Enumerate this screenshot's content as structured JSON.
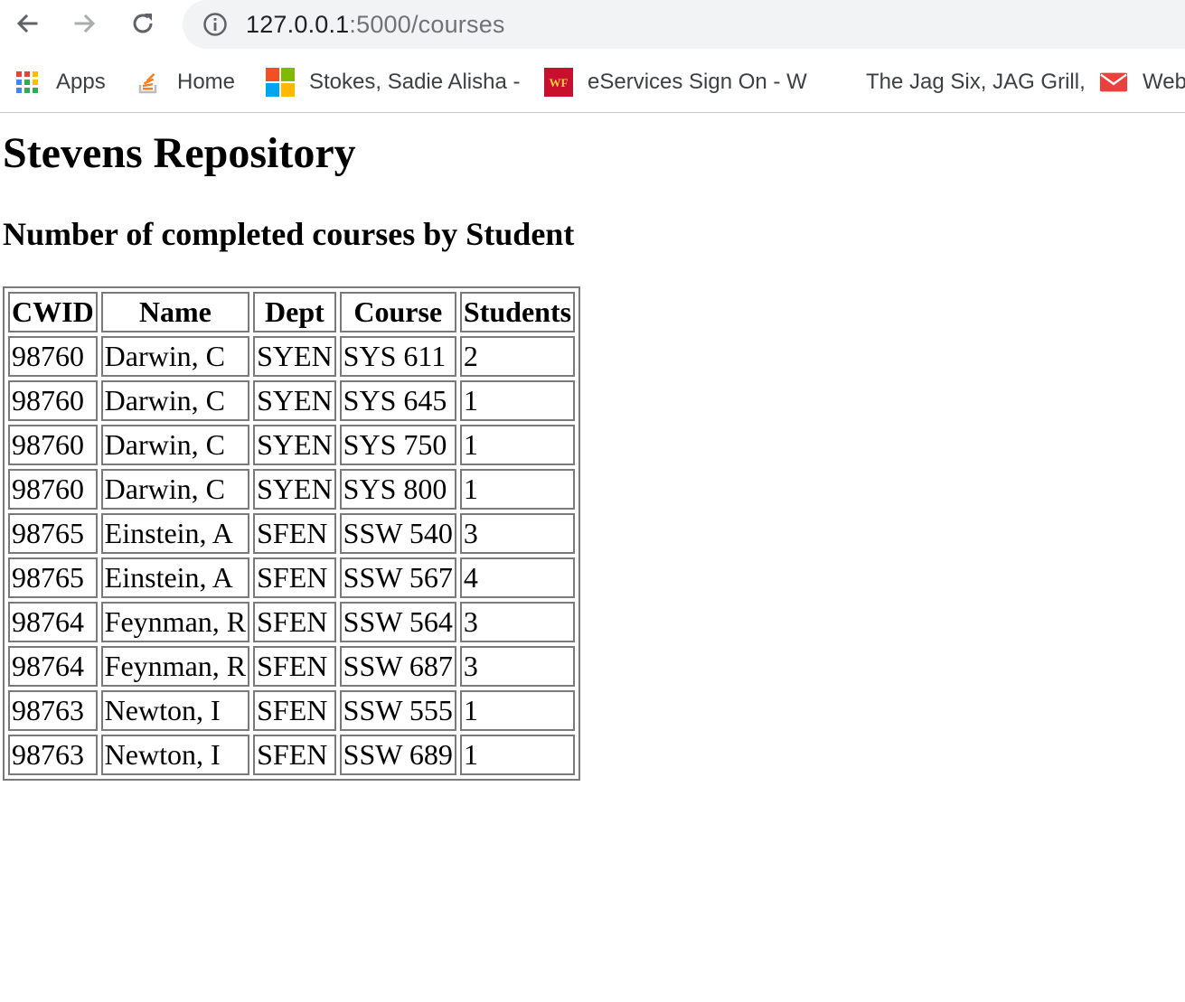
{
  "browser": {
    "url_host": "127.0.0.1",
    "url_path": ":5000/courses",
    "bookmarks": [
      {
        "label": "Apps",
        "icon": "apps-grid-icon"
      },
      {
        "label": "Home",
        "icon": "stackoverflow-icon"
      },
      {
        "label": "Stokes, Sadie Alisha -",
        "icon": "microsoft-icon"
      },
      {
        "label": "eServices Sign On - W",
        "icon": "wells-fargo-icon"
      },
      {
        "label": "The Jag Six, JAG Grill,",
        "icon": ""
      },
      {
        "label": "Web",
        "icon": "mail-envelope-icon"
      }
    ]
  },
  "page": {
    "title": "Stevens Repository",
    "subtitle": "Number of completed courses by Student"
  },
  "table": {
    "headers": [
      "CWID",
      "Name",
      "Dept",
      "Course",
      "Students"
    ],
    "rows": [
      [
        "98760",
        "Darwin, C",
        "SYEN",
        "SYS 611",
        "2"
      ],
      [
        "98760",
        "Darwin, C",
        "SYEN",
        "SYS 645",
        "1"
      ],
      [
        "98760",
        "Darwin, C",
        "SYEN",
        "SYS 750",
        "1"
      ],
      [
        "98760",
        "Darwin, C",
        "SYEN",
        "SYS 800",
        "1"
      ],
      [
        "98765",
        "Einstein, A",
        "SFEN",
        "SSW 540",
        "3"
      ],
      [
        "98765",
        "Einstein, A",
        "SFEN",
        "SSW 567",
        "4"
      ],
      [
        "98764",
        "Feynman, R",
        "SFEN",
        "SSW 564",
        "3"
      ],
      [
        "98764",
        "Feynman, R",
        "SFEN",
        "SSW 687",
        "3"
      ],
      [
        "98763",
        "Newton, I",
        "SFEN",
        "SSW 555",
        "1"
      ],
      [
        "98763",
        "Newton, I",
        "SFEN",
        "SSW 689",
        "1"
      ]
    ]
  }
}
